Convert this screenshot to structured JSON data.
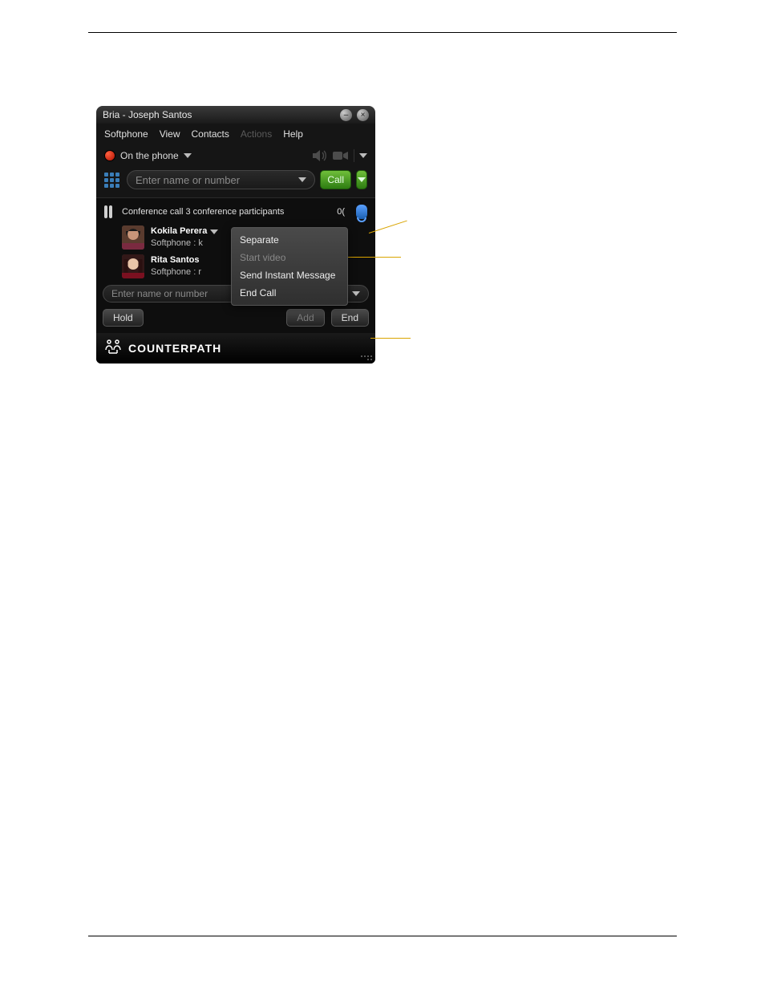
{
  "titlebar": {
    "title": "Bria - Joseph Santos"
  },
  "menu": {
    "softphone": "Softphone",
    "view": "View",
    "contacts": "Contacts",
    "actions": "Actions",
    "help": "Help"
  },
  "status": {
    "text": "On the phone"
  },
  "search": {
    "placeholder": "Enter name or number",
    "call_label": "Call"
  },
  "conf": {
    "header": "Conference call 3 conference participants",
    "timer": "0(",
    "participants": [
      {
        "name": "Kokila Perera",
        "sub": "Softphone :  k"
      },
      {
        "name": "Rita Santos",
        "sub": "Softphone :  r"
      }
    ]
  },
  "context_menu": {
    "separate": "Separate",
    "start_video": "Start video",
    "send_im": "Send Instant Message",
    "end_call": "End Call"
  },
  "add_row": {
    "placeholder": "Enter name or number"
  },
  "actions": {
    "hold": "Hold",
    "add": "Add",
    "end": "End"
  },
  "brand": {
    "name": "COUNTERPATH"
  }
}
